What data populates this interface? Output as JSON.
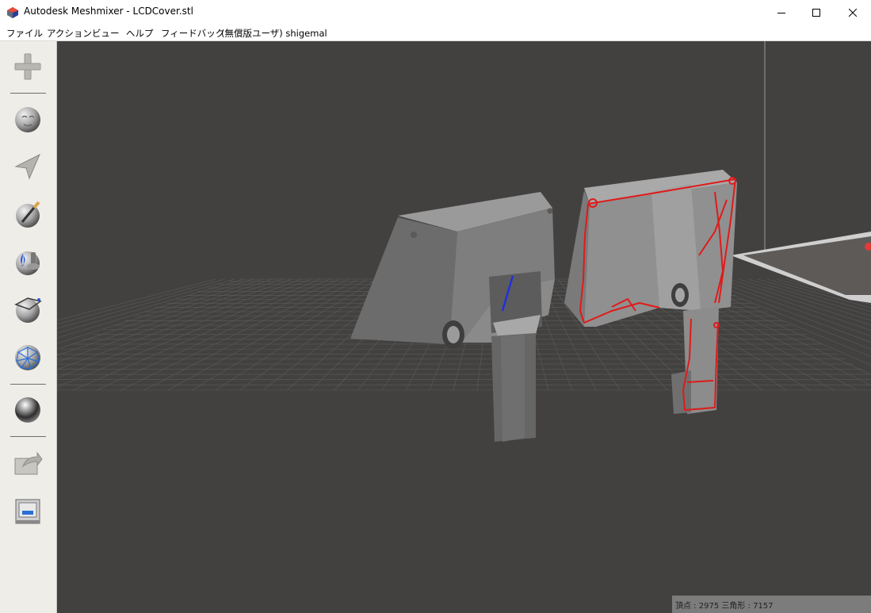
{
  "window": {
    "title": "Autodesk Meshmixer - LCDCover.stl",
    "icons": {
      "app": "meshmixer-logo-icon",
      "minimize": "minimize-icon",
      "maximize": "maximize-icon",
      "close": "close-icon"
    }
  },
  "menu": {
    "items": [
      "ファイル",
      "アクション",
      "ビュー",
      "ヘルプ",
      "フィードバック",
      "(無償版ユーザ) shigemal"
    ]
  },
  "toolbar": {
    "tools": [
      {
        "name": "import",
        "icon": "plus-icon"
      },
      {
        "name": "meshmix",
        "icon": "face-sphere-icon"
      },
      {
        "name": "select",
        "icon": "arrow-pointer-icon"
      },
      {
        "name": "sculpt",
        "icon": "brush-sphere-icon"
      },
      {
        "name": "stamp",
        "icon": "fleur-de-lis-sphere-icon"
      },
      {
        "name": "edit",
        "icon": "plane-cut-sphere-icon"
      },
      {
        "name": "analysis",
        "icon": "mesh-sphere-icon"
      },
      {
        "name": "shaders",
        "icon": "chrome-sphere-icon"
      },
      {
        "name": "export",
        "icon": "export-icon"
      },
      {
        "name": "print",
        "icon": "printer-icon"
      }
    ]
  },
  "status": {
    "text": "頂点 : 2975 三角形 : 7157"
  },
  "colors": {
    "viewport_bg": "#434140",
    "toolbar_bg": "#efede7",
    "model_gray": "#8a8a8a",
    "highlight_red": "#e01a1a",
    "edge_blue": "#2030e0"
  }
}
